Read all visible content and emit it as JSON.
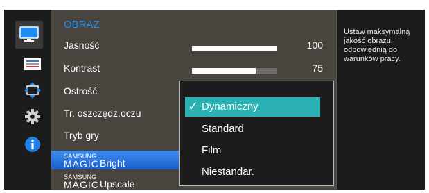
{
  "menu": {
    "title": "OBRAZ",
    "items": [
      {
        "label": "Jasność",
        "value": "100",
        "level": 1.0
      },
      {
        "label": "Kontrast",
        "value": "75",
        "level": 0.75
      },
      {
        "label": "Ostrość"
      },
      {
        "label": "Tr. oszczędz.oczu"
      },
      {
        "label": "Tryb gry"
      },
      {
        "brand_small": "SAMSUNG",
        "brand_big": "MAGIC",
        "label": "Bright"
      },
      {
        "brand_small": "SAMSUNG",
        "brand_big": "MAGIC",
        "label": "Upscale"
      }
    ]
  },
  "dropdown": {
    "options": [
      "Dynamiczny",
      "Standard",
      "Film",
      "Niestandar."
    ],
    "selected": "Dynamiczny",
    "check_glyph": "✓"
  },
  "help_text": "Ustaw maksymalną jakość obrazu, odpowiednią do warunków pracy.",
  "sidebar": {
    "icons": [
      "monitor-icon",
      "settings-bars-icon",
      "move-arrows-icon",
      "gear-icon",
      "info-icon"
    ]
  },
  "colors": {
    "title": "#1f8ef0",
    "selected_row": "#2a7be0",
    "selected_option": "#2bb0b3"
  }
}
